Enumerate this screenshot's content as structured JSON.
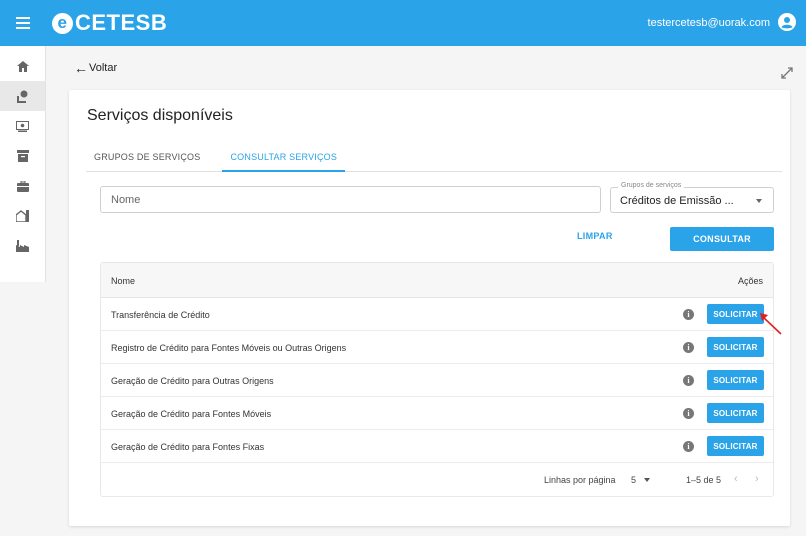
{
  "header": {
    "brand": "CETESB",
    "brand_mark": "e",
    "user_email": "testercetesb@uorak.com",
    "menu_icon": "hamburger-icon",
    "user_icon": "account-circle-icon"
  },
  "sidebar": {
    "items": [
      {
        "icon": "home-icon"
      },
      {
        "icon": "person-pin-icon",
        "active": true
      },
      {
        "icon": "card-icon"
      },
      {
        "icon": "archive-icon"
      },
      {
        "icon": "briefcase-icon"
      },
      {
        "icon": "house-icon"
      },
      {
        "icon": "factory-icon"
      }
    ]
  },
  "nav": {
    "back_label": "Voltar",
    "back_arrow": "←"
  },
  "page": {
    "title": "Serviços disponíveis"
  },
  "tabs": [
    {
      "label": "GRUPOS DE SERVIÇOS"
    },
    {
      "label": "CONSULTAR SERVIÇOS",
      "active": true
    }
  ],
  "filters": {
    "name_placeholder": "Nome",
    "name_value": "",
    "group_label": "Grupos de serviços",
    "group_value": "Créditos de Emissão ..."
  },
  "actions": {
    "clear_label": "LIMPAR",
    "search_label": "CONSULTAR"
  },
  "table": {
    "col_name": "Nome",
    "col_actions": "Ações",
    "rows": [
      {
        "name": "Transferência de Crédito",
        "action": "SOLICITAR",
        "info": "i"
      },
      {
        "name": "Registro de Crédito para Fontes Móveis ou Outras Origens",
        "action": "SOLICITAR",
        "info": "i"
      },
      {
        "name": "Geração de Crédito para Outras Origens",
        "action": "SOLICITAR",
        "info": "i"
      },
      {
        "name": "Geração de Crédito para Fontes Móveis",
        "action": "SOLICITAR",
        "info": "i"
      },
      {
        "name": "Geração de Crédito para Fontes Fixas",
        "action": "SOLICITAR",
        "info": "i"
      }
    ]
  },
  "pagination": {
    "rows_per_page_label": "Linhas por página",
    "rows_per_page_value": "5",
    "range_label": "1–5 de 5",
    "prev": "‹",
    "next": "›"
  },
  "colors": {
    "primary": "#2aa3e8",
    "annotation": "#e02020"
  }
}
